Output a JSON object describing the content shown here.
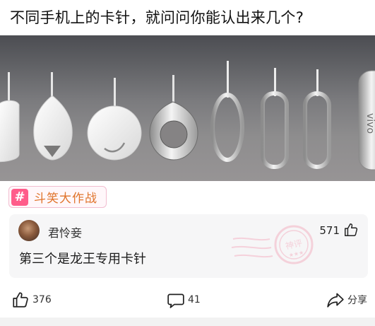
{
  "post": {
    "title": "不同手机上的卡针，就问问你能认出来几个?"
  },
  "photo": {
    "watermark_text": "vivo"
  },
  "topic": {
    "icon": "hash-icon",
    "label": "斗笑大作战",
    "accent_color": "#ff5c8a"
  },
  "god_comment": {
    "username": "君怜妾",
    "like_count": "571",
    "text": "第三个是龙王专用卡针",
    "stamp_text": "神评",
    "stamp_color": "#f4b3c4"
  },
  "actions": {
    "like_count": "376",
    "comment_count": "41",
    "share_label": "分享"
  }
}
